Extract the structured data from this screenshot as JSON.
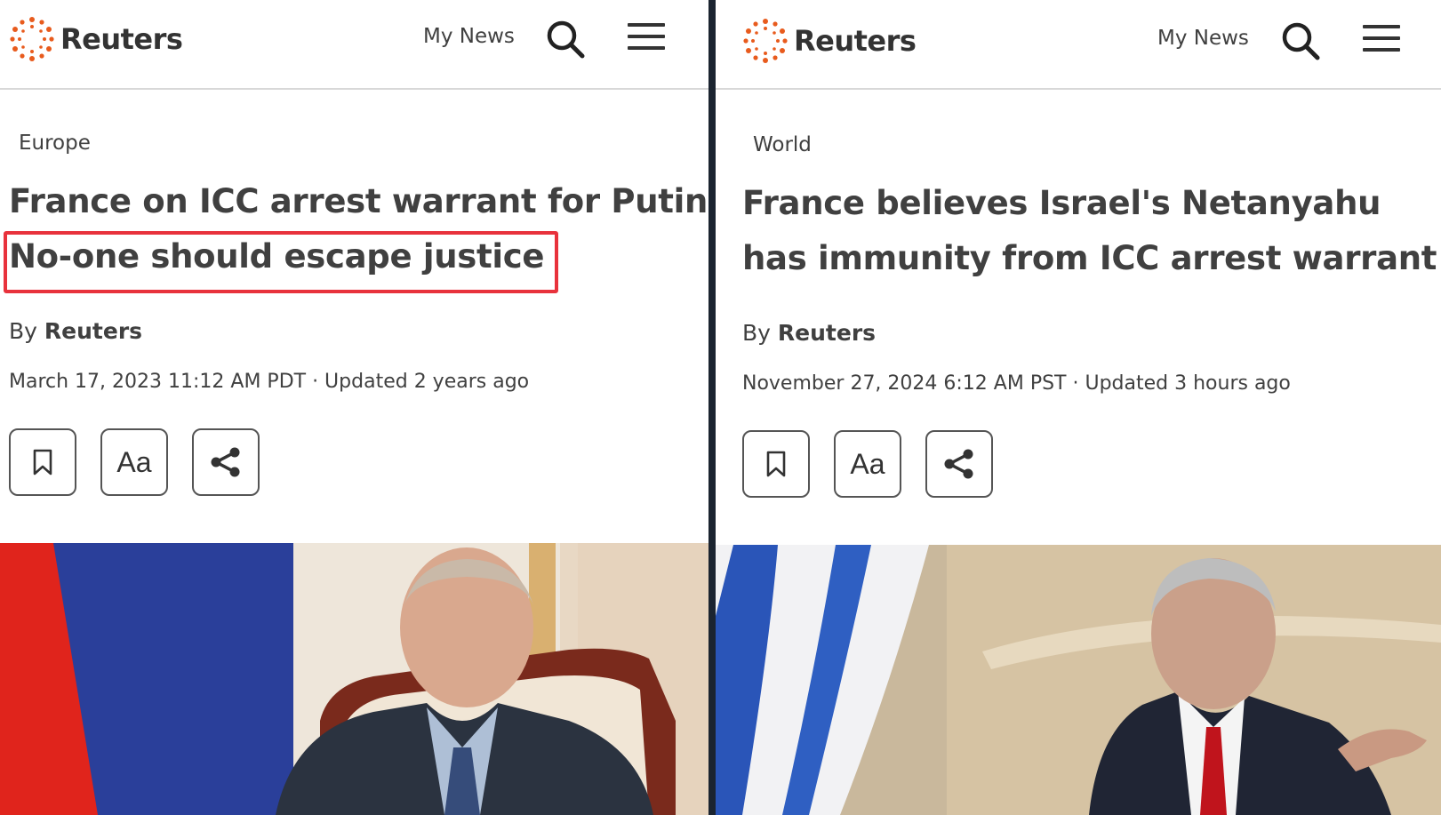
{
  "left": {
    "brand": "Reuters",
    "my_news": "My News",
    "category": "Europe",
    "headline_line1": "France on ICC arrest warrant for Putin:",
    "headline_line2": "No-one should escape justice",
    "byline_prefix": "By",
    "byline_author": "Reuters",
    "dateline": "March 17, 2023 11:12 AM PDT · Updated 2 years ago",
    "font_button_label": "Aa",
    "photo_icon": "photo-putin-flag"
  },
  "right": {
    "brand": "Reuters",
    "my_news": "My News",
    "category": "World",
    "headline_line1": "France believes Israel's Netanyahu",
    "headline_line2": "has immunity from ICC arrest warrant",
    "byline_prefix": "By",
    "byline_author": "Reuters",
    "dateline": "November 27, 2024 6:12 AM PST · Updated 3 hours ago",
    "font_button_label": "Aa",
    "photo_icon": "photo-netanyahu-flag"
  },
  "colors": {
    "brand_orange": "#e85b1d",
    "highlight_red": "#e8323c",
    "text": "#404040"
  }
}
